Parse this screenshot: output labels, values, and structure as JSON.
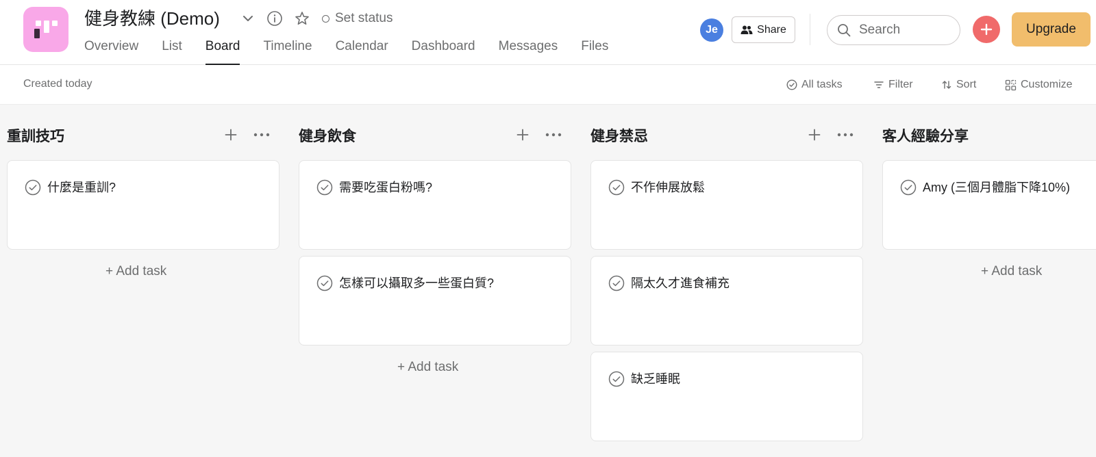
{
  "header": {
    "project_title": "健身教練 (Demo)",
    "set_status_label": "Set status",
    "tabs": [
      {
        "label": "Overview"
      },
      {
        "label": "List"
      },
      {
        "label": "Board"
      },
      {
        "label": "Timeline"
      },
      {
        "label": "Calendar"
      },
      {
        "label": "Dashboard"
      },
      {
        "label": "Messages"
      },
      {
        "label": "Files"
      }
    ],
    "active_tab": "Board",
    "avatar_initials": "Je",
    "share_label": "Share",
    "search_placeholder": "Search",
    "upgrade_label": "Upgrade",
    "icons": {
      "dropdown": "chevron-down-icon",
      "info": "info-icon",
      "favorite": "star-icon",
      "status": "circle-icon",
      "share": "people-icon",
      "search": "search-icon",
      "create": "plus-icon"
    }
  },
  "toolbar": {
    "created_text": "Created today",
    "all_tasks_label": "All tasks",
    "filter_label": "Filter",
    "sort_label": "Sort",
    "customize_label": "Customize"
  },
  "board": {
    "add_task_label": "+ Add task",
    "columns": [
      {
        "title": "重訓技巧",
        "tasks": [
          {
            "name": "什麼是重訓?"
          }
        ]
      },
      {
        "title": "健身飲食",
        "tasks": [
          {
            "name": "需要吃蛋白粉嗎?"
          },
          {
            "name": "怎樣可以攝取多一些蛋白質?"
          }
        ]
      },
      {
        "title": "健身禁忌",
        "tasks": [
          {
            "name": "不作伸展放鬆"
          },
          {
            "name": "隔太久才進食補充"
          },
          {
            "name": "缺乏睡眠"
          }
        ]
      },
      {
        "title": "客人經驗分享",
        "tasks": [
          {
            "name": "Amy (三個月體脂下降10%)"
          }
        ]
      }
    ]
  },
  "colors": {
    "project_icon": "#f9a8e8",
    "avatar": "#4a7fe0",
    "create_button": "#f06a6a",
    "upgrade_button": "#f1bd6c",
    "board_background": "#f6f6f6"
  }
}
